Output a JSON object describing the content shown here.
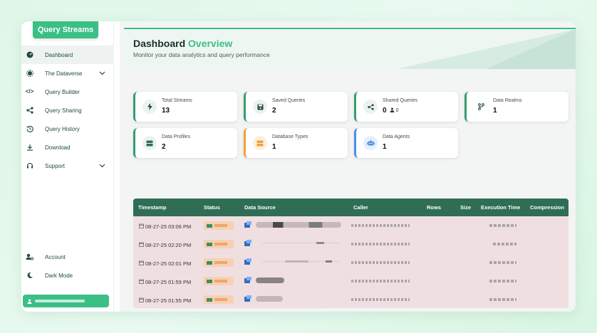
{
  "brand": "Query Streams",
  "sidebar": {
    "items": [
      {
        "label": "Dashboard",
        "icon": "dashboard-icon",
        "active": true
      },
      {
        "label": "The Dataverse",
        "icon": "dataverse-icon",
        "has_children": true
      },
      {
        "label": "Query Builder",
        "icon": "code-icon"
      },
      {
        "label": "Query Sharing",
        "icon": "share-icon"
      },
      {
        "label": "Query History",
        "icon": "history-icon"
      },
      {
        "label": "Download",
        "icon": "download-icon"
      },
      {
        "label": "Support",
        "icon": "headset-icon",
        "has_children": true
      }
    ],
    "bottom_items": [
      {
        "label": "Account",
        "icon": "user-gear-icon"
      },
      {
        "label": "Dark Mode",
        "icon": "moon-icon"
      }
    ]
  },
  "header": {
    "title_main": "Dashboard",
    "title_accent": "Overview",
    "subtitle": "Monitor your data analytics and query performance"
  },
  "cards": [
    {
      "label": "Total Streams",
      "value": "13",
      "icon": "bolt-icon"
    },
    {
      "label": "Saved Queries",
      "value": "2",
      "icon": "save-icon"
    },
    {
      "label": "Shared Queries",
      "value": "0",
      "extra": "0",
      "icon": "share-icon"
    },
    {
      "label": "Data Realms",
      "value": "1",
      "icon": "branch-icon"
    },
    {
      "label": "Data Profiles",
      "value": "2",
      "icon": "profile-icon"
    },
    {
      "label": "Database Types",
      "value": "1",
      "icon": "database-icon"
    },
    {
      "label": "Data Agents",
      "value": "1",
      "icon": "robot-icon"
    }
  ],
  "table": {
    "columns": [
      "Timestamp",
      "Status",
      "Data Source",
      "Caller",
      "Rows",
      "Size",
      "Execution Time",
      "Compression"
    ],
    "rows": [
      {
        "timestamp": "08-27-25 03:06 PM"
      },
      {
        "timestamp": "08-27-25 02:20 PM"
      },
      {
        "timestamp": "08-27-25 02:01 PM"
      },
      {
        "timestamp": "08-27-25 01:59 PM"
      },
      {
        "timestamp": "08-27-25 01:55 PM"
      }
    ]
  },
  "colors": {
    "accent": "#3bbf85",
    "table_header": "#2f6e55",
    "table_body": "#f0dfe0",
    "card_orange": "#f0a13a",
    "card_blue": "#4a8ee8"
  }
}
